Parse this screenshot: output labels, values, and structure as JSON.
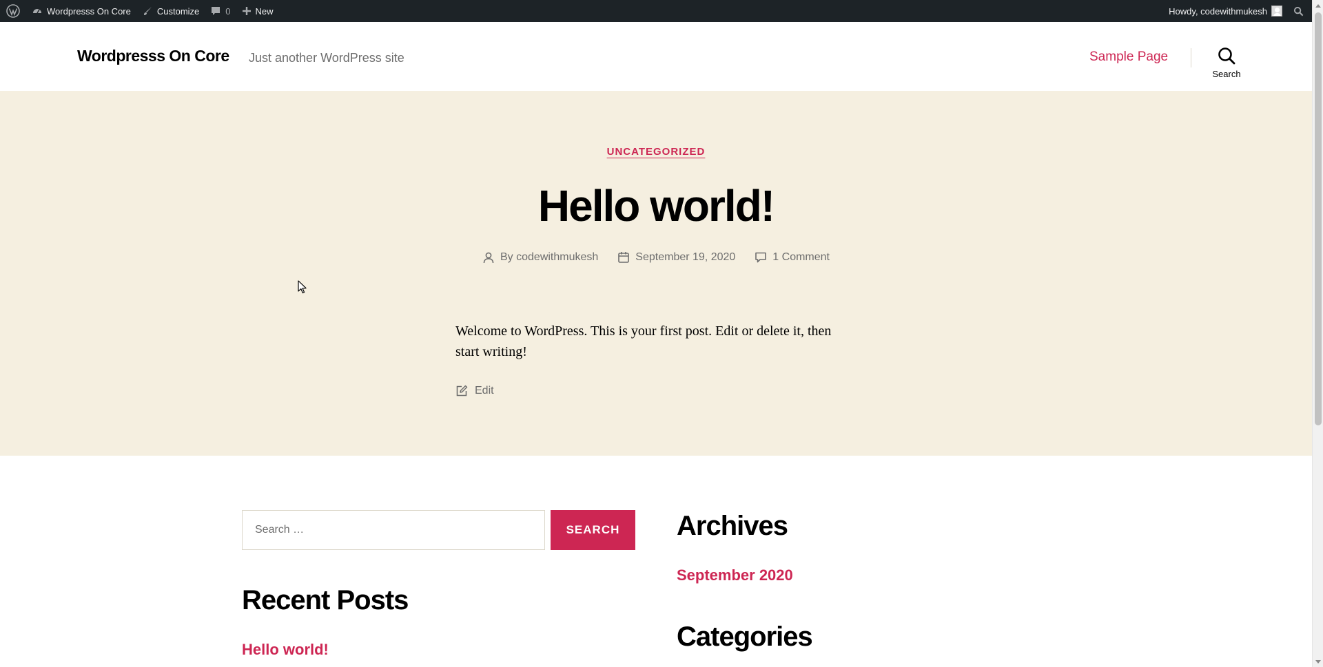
{
  "admin_bar": {
    "site_name": "Wordpresss On Core",
    "customize": "Customize",
    "comments_count": "0",
    "new_label": "New",
    "greeting": "Howdy, codewithmukesh"
  },
  "header": {
    "site_title": "Wordpresss On Core",
    "site_description": "Just another WordPress site",
    "nav": [
      {
        "label": "Sample Page"
      }
    ],
    "search_label": "Search"
  },
  "post": {
    "category": "UNCATEGORIZED",
    "title": "Hello world!",
    "author": "By codewithmukesh",
    "date": "September 19, 2020",
    "comments": "1 Comment",
    "body": "Welcome to WordPress. This is your first post. Edit or delete it, then start writing!",
    "edit_label": "Edit"
  },
  "widgets": {
    "search": {
      "placeholder": "Search …",
      "button_label": "SEARCH"
    },
    "recent_posts": {
      "heading": "Recent Posts",
      "items": [
        {
          "label": "Hello world!"
        }
      ]
    },
    "archives": {
      "heading": "Archives",
      "items": [
        {
          "label": "September 2020"
        }
      ]
    },
    "categories": {
      "heading": "Categories"
    }
  },
  "colors": {
    "accent": "#cd2653",
    "hero_background": "#f5efe0",
    "admin_bar": "#1d2327",
    "meta_text": "#6d6d6d"
  }
}
